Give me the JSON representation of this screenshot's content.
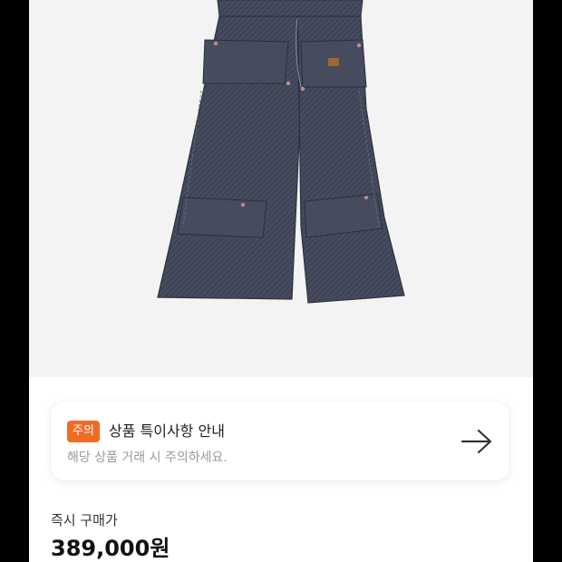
{
  "product": {
    "image_alt": "wide-leg double-knee denim pants"
  },
  "notice": {
    "badge": "주의",
    "title": "상품 특이사항 안내",
    "description": "해당 상품 거래 시 주의하세요.",
    "arrow_icon": "arrow-right-icon"
  },
  "price": {
    "label": "즉시 구매가",
    "value": "389,000원"
  },
  "colors": {
    "badge": "#ef6c25",
    "denim": "#3e4454",
    "image_background": "#f3f3f3"
  }
}
